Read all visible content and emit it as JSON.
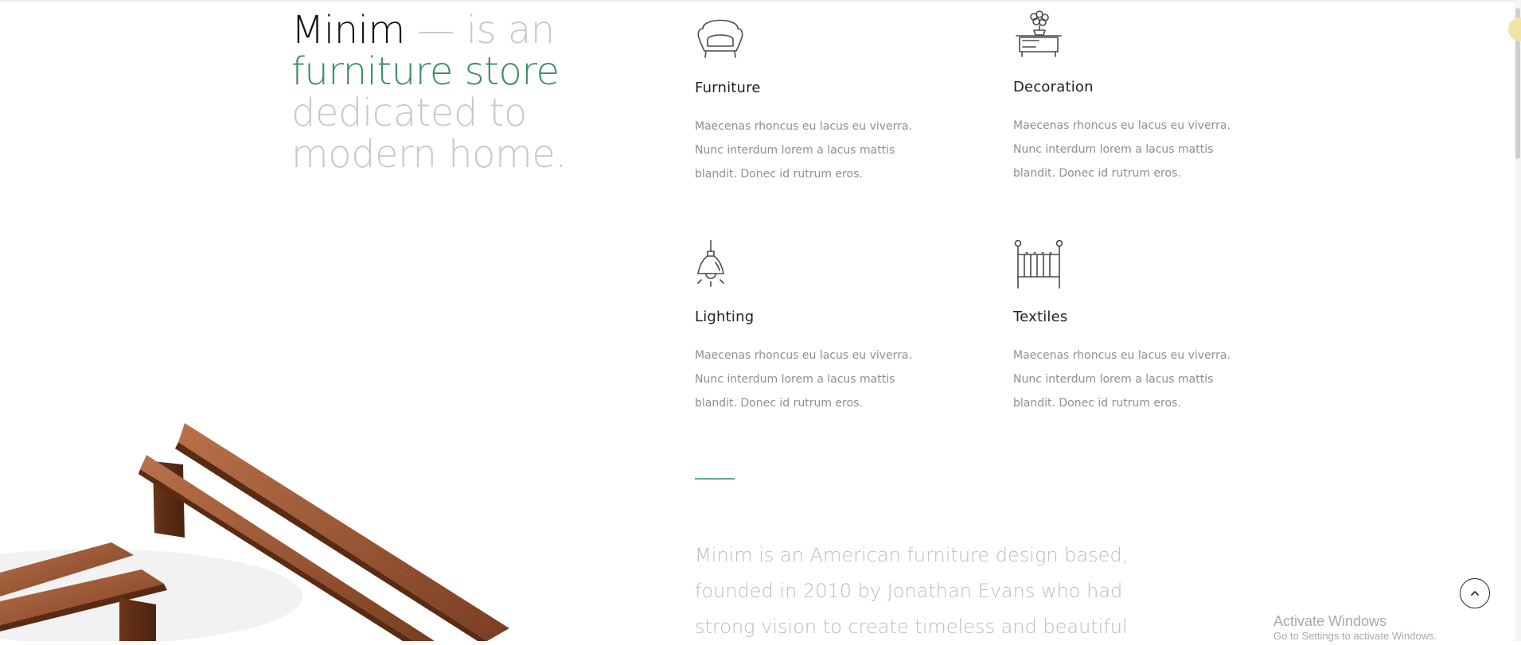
{
  "hero": {
    "brand": "Minim",
    "intro": " — is an",
    "accent": "furniture store",
    "line3": "dedicated to",
    "line4": "modern home."
  },
  "features": [
    {
      "title": "Furniture",
      "icon": "armchair-icon",
      "desc": "Maecenas rhoncus eu lacus eu viverra. Nunc interdum lorem a lacus mattis blandit. Donec id rutrum eros."
    },
    {
      "title": "Decoration",
      "icon": "plant-cabinet-icon",
      "desc": "Maecenas rhoncus eu lacus eu viverra. Nunc interdum lorem a lacus mattis blandit. Donec id rutrum eros."
    },
    {
      "title": "Lighting",
      "icon": "pendant-lamp-icon",
      "desc": "Maecenas rhoncus eu lacus eu viverra. Nunc interdum lorem a lacus mattis blandit. Donec id rutrum eros."
    },
    {
      "title": "Textiles",
      "icon": "crib-icon",
      "desc": "Maecenas rhoncus eu lacus eu viverra. Nunc interdum lorem a lacus mattis blandit. Donec id rutrum eros."
    }
  ],
  "about": {
    "text": "Minim is an American furniture design based, founded in 2010 by Jonathan Evans who had strong vision to create timeless and beautiful"
  },
  "watermark": {
    "line1": "Activate Windows",
    "line2": "Go to Settings to activate Windows."
  },
  "colors": {
    "accent_green": "#3f8f5f",
    "muted_text": "#c9c9c9",
    "wood": "#8a4b2b"
  }
}
